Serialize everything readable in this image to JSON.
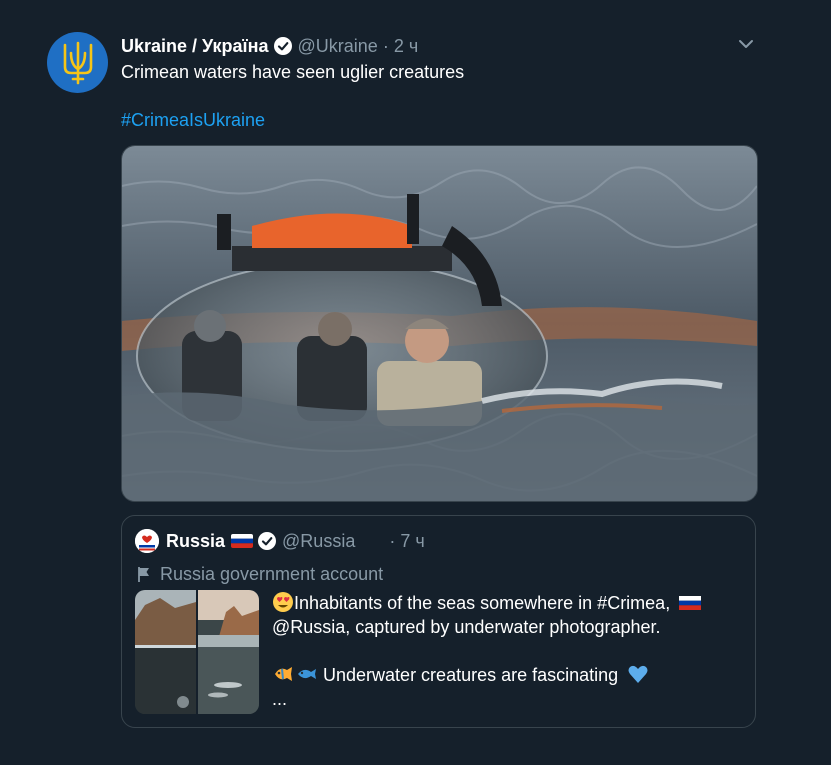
{
  "tweet": {
    "display_name": "Ukraine / Україна",
    "handle": "@Ukraine",
    "separator": "·",
    "time": "2 ч",
    "text": "Crimean waters have seen uglier creatures",
    "hashtag": "#CrimeaIsUkraine",
    "avatar_icon": "trident-icon",
    "media_description_icon": "submarine-photo"
  },
  "quote": {
    "display_name": "Russia",
    "handle": "@Russia",
    "separator": "·",
    "time": "7 ч",
    "label": "Russia government account",
    "line1": "Inhabitants of the seas somewhere in #Crimea,",
    "line2": "@Russia, captured by underwater photographer.",
    "line3": "Underwater creatures are fascinating",
    "line4": "..."
  },
  "colors": {
    "background": "#15202b",
    "link": "#1da1f2",
    "secondary": "#8899a6",
    "border": "#38444d"
  }
}
